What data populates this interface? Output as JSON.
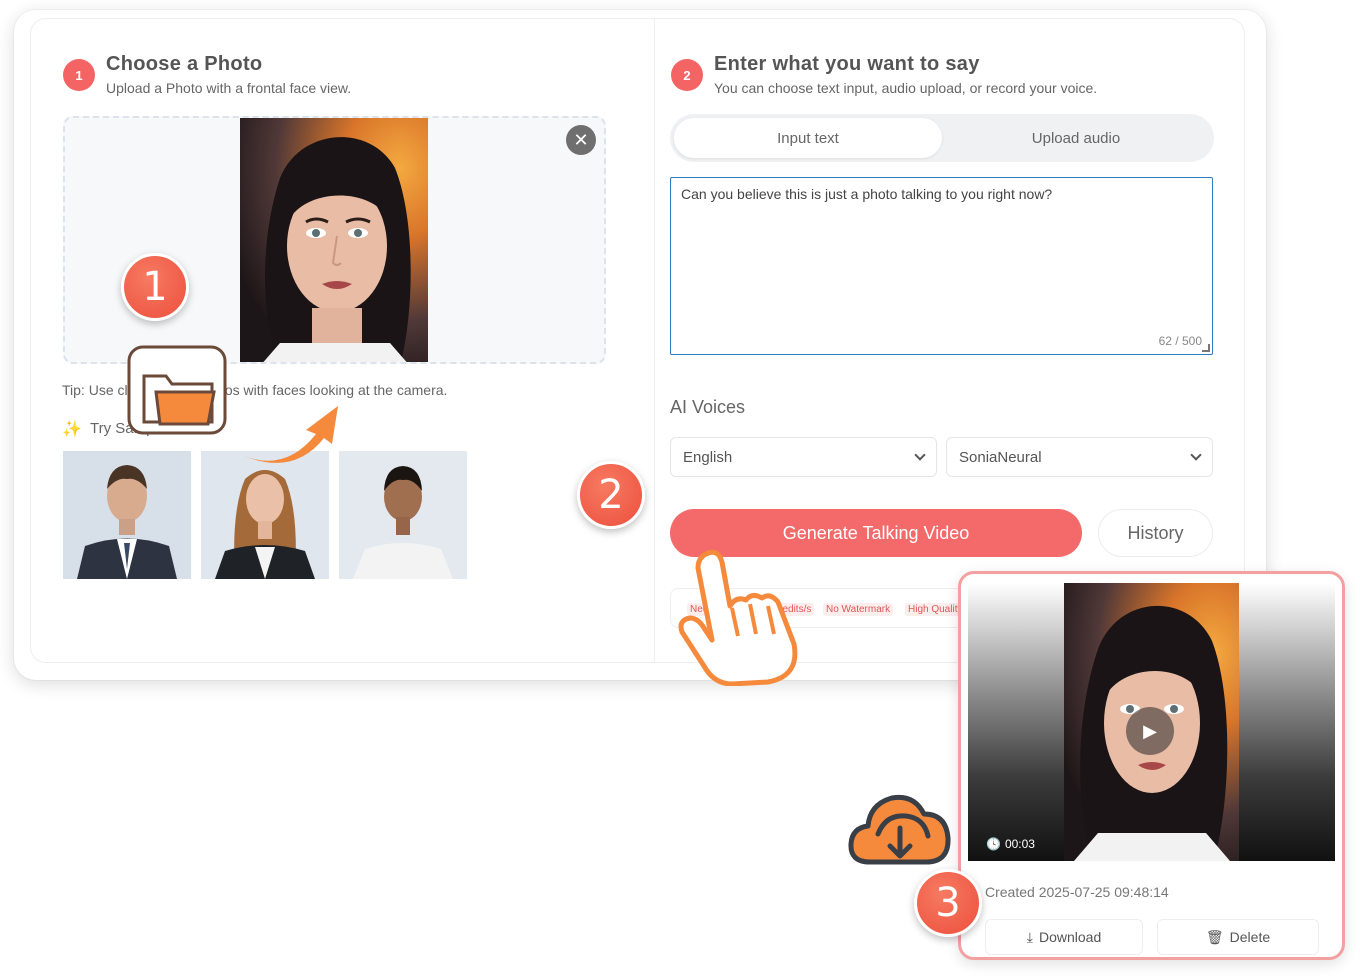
{
  "step1": {
    "number": "1",
    "title": "Choose a Photo",
    "subtitle": "Upload a Photo with a frontal face view.",
    "tip": "Tip: Use clear, well-lit photos with faces looking at the camera.",
    "try_samples": "Try Samples"
  },
  "step2": {
    "number": "2",
    "title": "Enter what you want to say",
    "subtitle": "You can choose text input, audio upload, or record your voice.",
    "tabs": [
      {
        "label": "Input text"
      },
      {
        "label": "Upload audio"
      }
    ],
    "text_value": "Can you believe this is just a photo talking to you right now?",
    "counter": "62 / 500",
    "voices_label": "AI Voices",
    "language": "English",
    "voice": "SoniaNeural",
    "generate_label": "Generate Talking Video",
    "history_label": "History",
    "badges": [
      "Need Login",
      "20 Credits/s",
      "No Watermark",
      "High Quality"
    ]
  },
  "overlay": {
    "big_numbers": [
      "1",
      "2",
      "3"
    ]
  },
  "result": {
    "duration": "00:03",
    "created": "Created 2025-07-25 09:48:14",
    "download_label": "Download",
    "delete_label": "Delete"
  },
  "colors": {
    "accent": "#f46464",
    "accent_light": "#f4a0a0",
    "orange": "#f58a3c",
    "icon_brown": "#6b4a3a"
  },
  "icons": [
    "close-icon",
    "sparkle-icon",
    "chevron-down-icon",
    "play-icon",
    "clock-icon",
    "download-icon",
    "trash-icon",
    "folder-icon",
    "arrow-icon",
    "hand-pointer-icon",
    "cloud-download-icon"
  ]
}
